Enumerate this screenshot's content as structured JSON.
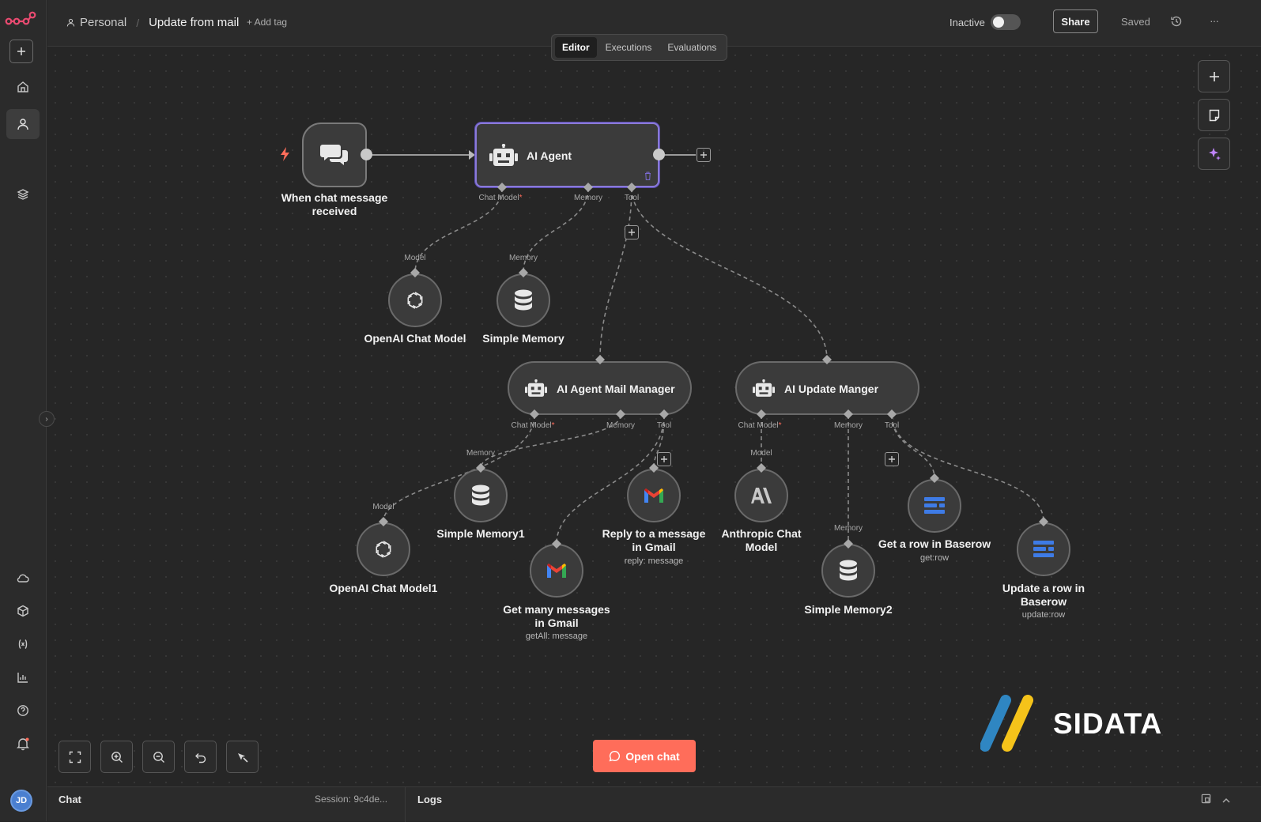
{
  "header": {
    "project": "Personal",
    "workflow_name": "Update from mail",
    "add_tag": "+ Add tag",
    "status_label": "Inactive",
    "share_label": "Share",
    "saved_label": "Saved",
    "more_label": "···"
  },
  "tabs": [
    "Editor",
    "Executions",
    "Evaluations"
  ],
  "nodes": {
    "trigger": {
      "label": "When chat message received"
    },
    "agent": {
      "label": "AI Agent",
      "ports": {
        "chat_model": "Chat Model",
        "memory": "Memory",
        "tool": "Tool"
      }
    },
    "openai1": {
      "label": "OpenAI Chat Model",
      "port": "Model"
    },
    "memory1": {
      "label": "Simple Memory",
      "port": "Memory"
    },
    "mail_manager": {
      "label": "AI Agent Mail Manager",
      "ports": {
        "chat_model": "Chat Model",
        "memory": "Memory",
        "tool": "Tool"
      }
    },
    "update_manager": {
      "label": "AI Update Manger",
      "ports": {
        "chat_model": "Chat Model",
        "memory": "Memory",
        "tool": "Tool"
      }
    },
    "openai2": {
      "label": "OpenAI Chat Model1",
      "port": "Model"
    },
    "memory2": {
      "label": "Simple Memory1",
      "port": "Memory"
    },
    "gmail_getall": {
      "label": "Get many messages in Gmail",
      "subtitle": "getAll: message"
    },
    "gmail_reply": {
      "label": "Reply to a message in Gmail",
      "subtitle": "reply: message"
    },
    "anthropic": {
      "label": "Anthropic Chat Model",
      "port": "Model"
    },
    "memory3": {
      "label": "Simple Memory2",
      "port": "Memory"
    },
    "baserow_get": {
      "label": "Get a row in Baserow",
      "subtitle": "get:row"
    },
    "baserow_update": {
      "label": "Update a row in Baserow",
      "subtitle": "update:row"
    }
  },
  "open_chat": "Open chat",
  "watermark": "SIDATA",
  "bottom": {
    "chat": "Chat",
    "session": "Session: 9c4de...",
    "logs": "Logs"
  },
  "avatar_initials": "JD",
  "colors": {
    "accent": "#ff6d5a",
    "node_bg": "#3d3d3d",
    "selected_border": "#8a7ad8",
    "ai_sparkle": "#c084fc"
  }
}
